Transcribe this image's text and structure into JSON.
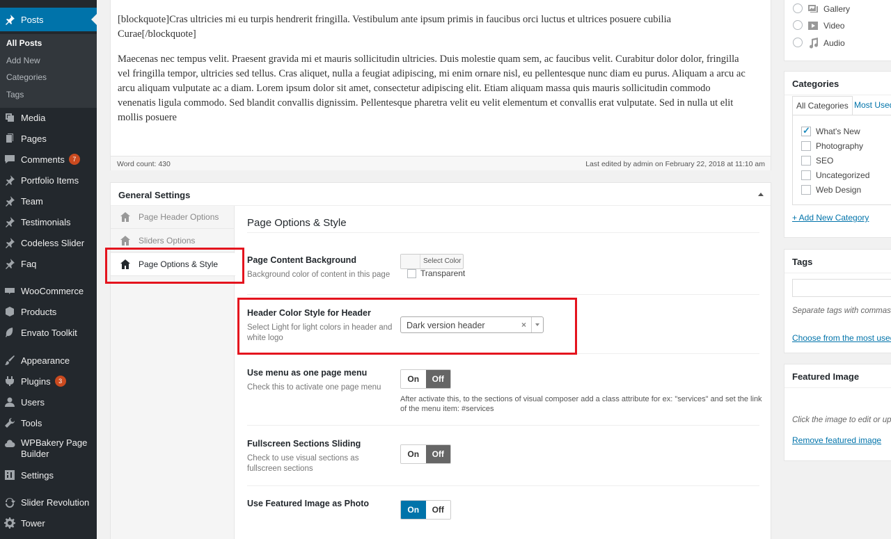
{
  "sidebar": {
    "current": "Posts",
    "submenu": [
      "All Posts",
      "Add New",
      "Categories",
      "Tags"
    ],
    "items": [
      {
        "label": "Media"
      },
      {
        "label": "Pages"
      },
      {
        "label": "Comments",
        "badge": "7"
      },
      {
        "label": "Portfolio Items"
      },
      {
        "label": "Team"
      },
      {
        "label": "Testimonials"
      },
      {
        "label": "Codeless Slider"
      },
      {
        "label": "Faq"
      },
      {
        "label": "WooCommerce"
      },
      {
        "label": "Products"
      },
      {
        "label": "Envato Toolkit"
      },
      {
        "label": "Appearance"
      },
      {
        "label": "Plugins",
        "badge": "3"
      },
      {
        "label": "Users"
      },
      {
        "label": "Tools"
      },
      {
        "label": "WPBakery Page",
        "label2": "Builder"
      },
      {
        "label": "Settings"
      },
      {
        "label": "Slider Revolution"
      },
      {
        "label": "Tower"
      }
    ]
  },
  "editor": {
    "paragraph1": "[blockquote]Cras ultricies mi eu turpis hendrerit fringilla. Vestibulum ante ipsum primis in faucibus orci luctus et ultrices posuere cubilia Curae[/blockquote]",
    "paragraph2": "Maecenas nec tempus velit. Praesent gravida mi et mauris sollicitudin ultricies. Duis molestie quam sem, ac faucibus velit. Curabitur dolor dolor, fringilla vel fringilla tempor, ultricies sed tellus. Cras aliquet, nulla a feugiat adipiscing, mi enim ornare nisl, eu pellentesque nunc diam eu purus. Aliquam a arcu ac arcu aliquam vulputate ac a diam. Lorem ipsum dolor sit amet, consectetur adipiscing elit. Etiam aliquam massa quis mauris sollicitudin commodo venenatis ligula commodo. Sed blandit convallis dignissim. Pellentesque pharetra velit eu velit elementum et convallis erat vulputate. Sed in nulla ut elit mollis posuere",
    "word_count": "Word count: 430",
    "last_edited": "Last edited by admin on February 22, 2018 at 11:10 am"
  },
  "general_settings": {
    "title": "General Settings",
    "tabs": [
      "Page Header Options",
      "Sliders Options",
      "Page Options & Style"
    ],
    "panel_title": "Page Options & Style",
    "options": {
      "bg": {
        "label": "Page Content Background",
        "desc": "Background color of content in this page",
        "button": "Select Color",
        "transparent": "Transparent"
      },
      "header_style": {
        "label": "Header Color Style for Header",
        "desc": "Select Light for light colors in header and white logo",
        "value": "Dark version header",
        "clear": "×"
      },
      "one_page": {
        "label": "Use menu as one page menu",
        "desc": "Check this to activate one page menu",
        "note": "After activate this, to the sections of visual composer add a class attribute for ex: \"services\" and set the link of the menu item: #services"
      },
      "fullscreen": {
        "label": "Fullscreen Sections Sliding",
        "desc": "Check to use visual sections as fullscreen sections"
      },
      "featured": {
        "label": "Use Featured Image as Photo"
      }
    },
    "toggle_on": "On",
    "toggle_off": "Off"
  },
  "right": {
    "formats": [
      "Gallery",
      "Video",
      "Audio"
    ],
    "categories": {
      "title": "Categories",
      "tab_all": "All Categories",
      "tab_used": "Most Used",
      "items": [
        {
          "label": "What's New",
          "checked": true
        },
        {
          "label": "Photography",
          "checked": false
        },
        {
          "label": "SEO",
          "checked": false
        },
        {
          "label": "Uncategorized",
          "checked": false
        },
        {
          "label": "Web Design",
          "checked": false
        }
      ],
      "add_new": "+ Add New Category"
    },
    "tags": {
      "title": "Tags",
      "note": "Separate tags with commas",
      "choose": "Choose from the most used"
    },
    "featured": {
      "title": "Featured Image",
      "note": "Click the image to edit or update",
      "remove": "Remove featured image"
    }
  },
  "colors": {
    "accent": "#0073aa",
    "sidebar": "#23282d",
    "highlight": "#e4141e"
  }
}
